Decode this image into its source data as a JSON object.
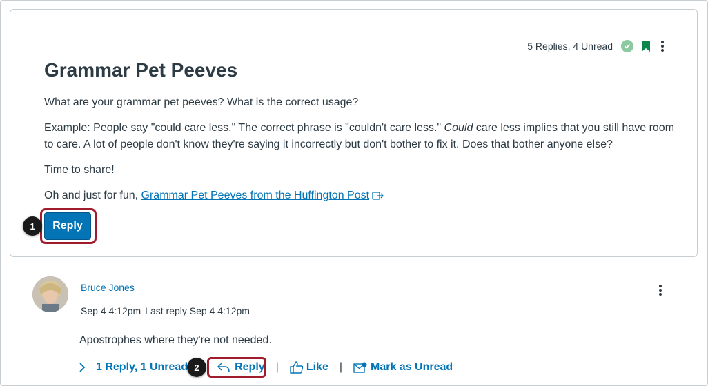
{
  "topic": {
    "counts": "5 Replies, 4 Unread",
    "title": "Grammar Pet Peeves",
    "paragraph1": "What are your grammar pet peeves? What is the correct usage?",
    "paragraph2_a": "Example: People say \"could care less.\" The correct phrase is \"couldn't care less.\" ",
    "paragraph2_em": "Could",
    "paragraph2_b": " care less implies that you still have room to care. A lot of people don't know they're saying it incorrectly but don't bother to fix it. Does that bother anyone else?",
    "paragraph3": "Time to share!",
    "paragraph4_prefix": "Oh and just for fun, ",
    "link_text": "Grammar Pet Peeves from the Huffington Post",
    "reply_label": "Reply",
    "colors": {
      "accent": "#0374b5",
      "bookmark": "#0b874b",
      "read": "#8bc9a0",
      "highlight": "#a01b2b"
    }
  },
  "callouts": {
    "first": "1",
    "second": "2"
  },
  "entry": {
    "author": "Bruce Jones",
    "posted": "Sep 4 4:12pm",
    "last_reply": "Last reply Sep 4 4:12pm",
    "message": "Apostrophes where they're not needed.",
    "replies_toggle": "1 Reply, 1 Unread",
    "reply_label": "Reply",
    "like_label": "Like",
    "mark_unread_label": "Mark as Unread",
    "separator": "|"
  },
  "icons": {
    "read": "checkmark-circle-icon",
    "bookmark": "bookmark-icon",
    "kebab": "more-options-icon",
    "external": "external-link-icon",
    "expand": "chevron-right-icon",
    "reply": "reply-arrow-icon",
    "like": "thumbs-up-icon",
    "unread": "mark-unread-icon"
  }
}
